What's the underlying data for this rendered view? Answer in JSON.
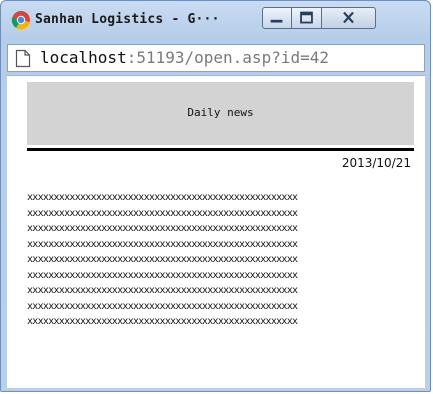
{
  "window": {
    "title": "Sanhan Logistics - G···",
    "app_icon": "chrome-icon",
    "controls": {
      "minimize_icon": "minimize-icon",
      "maximize_icon": "maximize-icon",
      "close_icon": "close-icon"
    }
  },
  "address_bar": {
    "page_icon": "page-icon",
    "host": "localhost",
    "path": ":51193/open.asp?id=42"
  },
  "page": {
    "header_title": "Daily news",
    "date": "2013/10/21",
    "body_lines": [
      "xxxxxxxxxxxxxxxxxxxxxxxxxxxxxxxxxxxxxxxxxxxxxxxxxxx",
      "xxxxxxxxxxxxxxxxxxxxxxxxxxxxxxxxxxxxxxxxxxxxxxxxxxx",
      "xxxxxxxxxxxxxxxxxxxxxxxxxxxxxxxxxxxxxxxxxxxxxxxxxxx",
      "xxxxxxxxxxxxxxxxxxxxxxxxxxxxxxxxxxxxxxxxxxxxxxxxxxx",
      "xxxxxxxxxxxxxxxxxxxxxxxxxxxxxxxxxxxxxxxxxxxxxxxxxxx",
      "xxxxxxxxxxxxxxxxxxxxxxxxxxxxxxxxxxxxxxxxxxxxxxxxxxx",
      "xxxxxxxxxxxxxxxxxxxxxxxxxxxxxxxxxxxxxxxxxxxxxxxxxxx",
      "xxxxxxxxxxxxxxxxxxxxxxxxxxxxxxxxxxxxxxxxxxxxxxxxxxx",
      "xxxxxxxxxxxxxxxxxxxxxxxxxxxxxxxxxxxxxxxxxxxxxxxxxxx"
    ]
  },
  "colors": {
    "header_bg": "#d3d3d3",
    "rule": "#000000",
    "frame": "#b9d0ec"
  }
}
